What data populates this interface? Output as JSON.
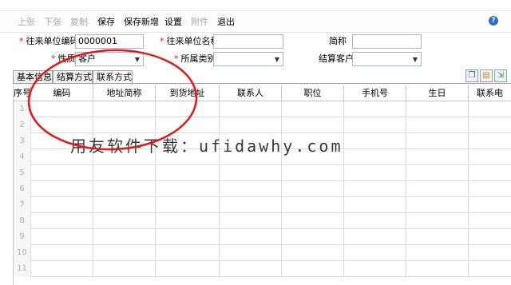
{
  "toolbar": {
    "prev": "上张",
    "next": "下张",
    "copy": "复制",
    "save": "保存",
    "save_new": "保存新增",
    "settings": "设置",
    "attach": "附件",
    "exit": "退出",
    "help_glyph": "?"
  },
  "form": {
    "required_mark": "*",
    "code_label": "往来单位编码",
    "code_value": "0000001",
    "name_label": "往来单位名称",
    "name_value": "",
    "short_label": "简称",
    "short_value": "",
    "nature_label": "性质",
    "nature_value": "客户",
    "category_label": "所属类别",
    "category_value": "",
    "settle_label": "结算客户",
    "settle_value": ""
  },
  "tabs": [
    "基本信息",
    "结算方式",
    "联系方式"
  ],
  "active_tab": "联系方式",
  "grid": {
    "columns": [
      "序号",
      "编码",
      "地址简称",
      "到货地址",
      "联系人",
      "职位",
      "手机号",
      "生日",
      "联系电"
    ],
    "rows": [
      "1",
      "2",
      "3",
      "4",
      "5",
      "6",
      "7",
      "8",
      "9",
      "10",
      "11"
    ]
  },
  "watermark": "用友软件下载：ufidawhy.com",
  "colors": {
    "required": "#d21e1e",
    "annotation": "#e0191c",
    "help": "#2a6fc9",
    "disabled_text": "#a8a8a8"
  },
  "icons": [
    "help-icon",
    "dropdown-arrow-icon",
    "copy-row-icon",
    "paste-row-icon",
    "export-icon"
  ]
}
